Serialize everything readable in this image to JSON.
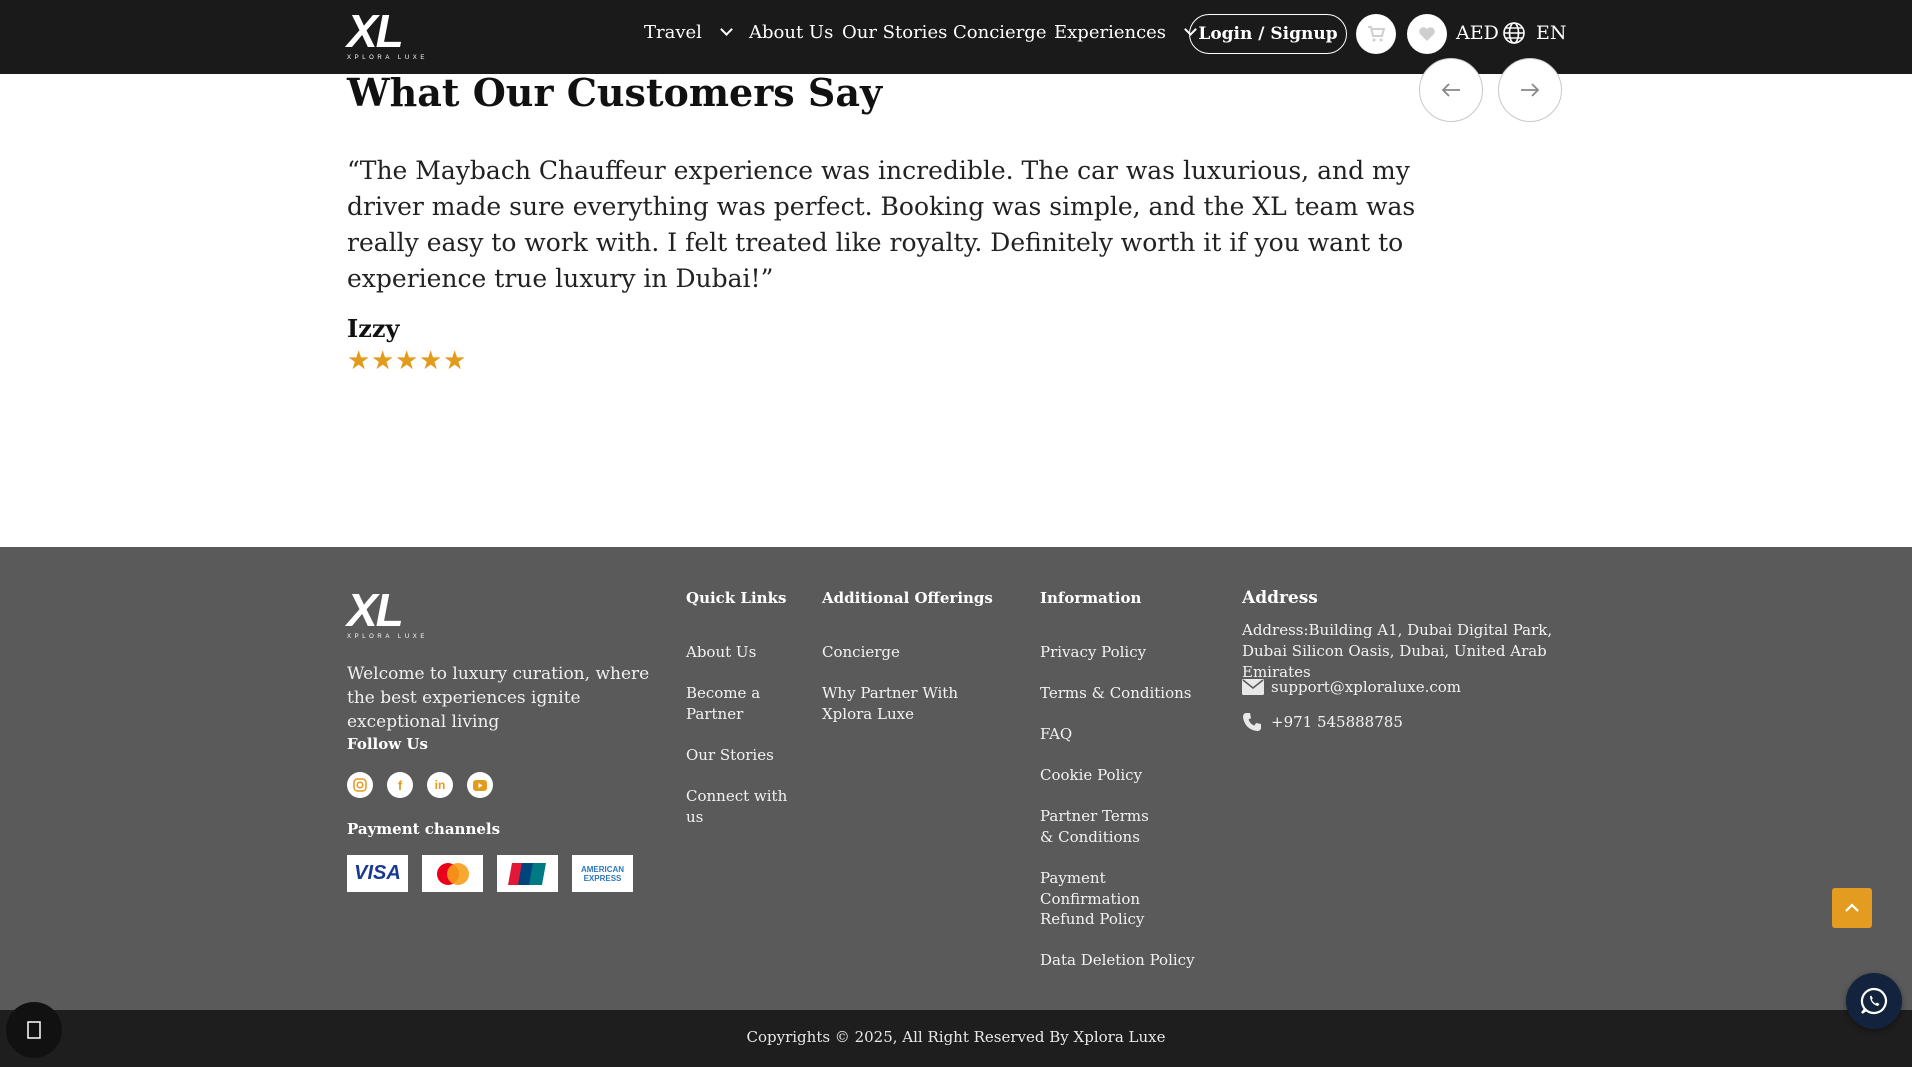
{
  "header": {
    "logo_text": "XL",
    "logo_subtext": "XPLORA LUXE",
    "nav": [
      {
        "label": "Travel",
        "dropdown": true
      },
      {
        "label": "About Us",
        "dropdown": false
      },
      {
        "label": "Our Stories",
        "dropdown": false
      },
      {
        "label": "Concierge",
        "dropdown": false
      },
      {
        "label": "Experiences",
        "dropdown": true
      }
    ],
    "login_label": "Login / Signup",
    "currency": "AED",
    "language": "EN"
  },
  "testimonials": {
    "title": "What Our Customers Say",
    "quote": "“The Maybach Chauffeur experience was incredible. The car was luxurious, and my driver made sure everything was perfect. Booking was simple, and the XL team was really easy to work with. I felt treated like royalty. Definitely worth it if you want to experience true luxury in Dubai!”",
    "author": "Izzy",
    "rating": 5
  },
  "footer": {
    "logo_text": "XL",
    "logo_subtext": "XPLORA LUXE",
    "tagline": "Welcome to luxury curation, where the best experiences ignite exceptional living",
    "follow_label": "Follow Us",
    "payment_label": "Payment channels",
    "payments": [
      "VISA",
      "Mastercard",
      "UnionPay",
      "AMERICAN EXPRESS"
    ],
    "quick_links": {
      "heading": "Quick Links",
      "items": [
        "About Us",
        "Become a Partner",
        "Our Stories",
        "Connect with us"
      ]
    },
    "additional": {
      "heading": "Additional Offerings",
      "items": [
        "Concierge",
        "Why Partner With Xplora Luxe"
      ]
    },
    "information": {
      "heading": "Information",
      "items": [
        "Privacy Policy",
        "Terms & Conditions",
        "FAQ",
        "Cookie Policy",
        "Partner Terms & Conditions",
        "Payment Confirmation",
        "Refund Policy",
        "Data Deletion Policy"
      ]
    },
    "address": {
      "heading": "Address",
      "text": "Address:Building A1, Dubai Digital Park, Dubai Silicon Oasis, Dubai, United Arab Emirates",
      "email": "support@xploraluxe.com",
      "phone": "+971 545888785"
    },
    "copyright": "Copyrights © 2025, All Right Reserved By Xplora Luxe"
  },
  "colors": {
    "header_bg": "#1a1a1a",
    "footer_bg": "#5a5a5a",
    "accent_gold": "#e29b1c"
  }
}
